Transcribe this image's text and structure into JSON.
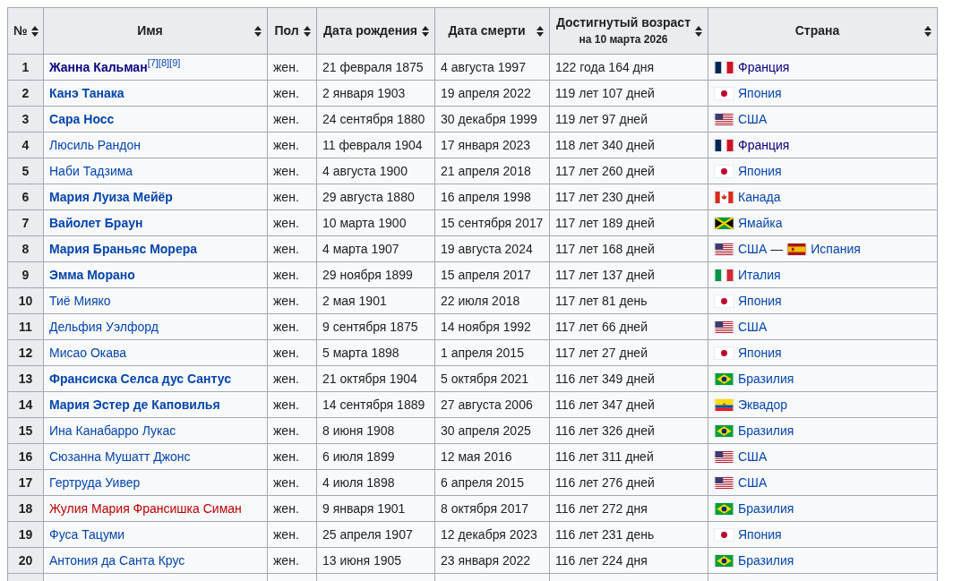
{
  "table": {
    "columns": [
      {
        "label": "№"
      },
      {
        "label": "Имя"
      },
      {
        "label": "Пол"
      },
      {
        "label": "Дата рождения"
      },
      {
        "label": "Дата смерти"
      },
      {
        "label": "Достигнутый возраст",
        "sublabel": "на 10 марта 2026"
      },
      {
        "label": "Страна"
      }
    ],
    "rows": [
      {
        "number": "1",
        "name": "Жанна Кальман",
        "bold": true,
        "visited": true,
        "missing": false,
        "refs": [
          "[7]",
          "[8]",
          "[9]"
        ],
        "sex": "жен.",
        "born": "21 февраля 1875",
        "died": "4 августа 1997",
        "age": "122 года 164 дня",
        "countries": [
          {
            "kind": "fr",
            "name": "Франция",
            "visited": true
          }
        ]
      },
      {
        "number": "2",
        "name": "Канэ Танака",
        "bold": true,
        "visited": false,
        "missing": false,
        "sex": "жен.",
        "born": "2 января 1903",
        "died": "19 апреля 2022",
        "age": "119 лет 107 дней",
        "countries": [
          {
            "kind": "jp",
            "name": "Япония",
            "visited": false
          }
        ]
      },
      {
        "number": "3",
        "name": "Сара Носс",
        "bold": true,
        "visited": false,
        "missing": false,
        "sex": "жен.",
        "born": "24 сентября 1880",
        "died": "30 декабря 1999",
        "age": "119 лет 97 дней",
        "countries": [
          {
            "kind": "us",
            "name": "США",
            "visited": false
          }
        ]
      },
      {
        "number": "4",
        "name": "Люсиль Рандон",
        "bold": false,
        "visited": false,
        "missing": false,
        "sex": "жен.",
        "born": "11 февраля 1904",
        "died": "17 января 2023",
        "age": "118 лет 340 дней",
        "countries": [
          {
            "kind": "fr",
            "name": "Франция",
            "visited": true
          }
        ]
      },
      {
        "number": "5",
        "name": "Наби Тадзима",
        "bold": false,
        "visited": false,
        "missing": false,
        "sex": "жен.",
        "born": "4 августа 1900",
        "died": "21 апреля 2018",
        "age": "117 лет 260 дней",
        "countries": [
          {
            "kind": "jp",
            "name": "Япония",
            "visited": false
          }
        ]
      },
      {
        "number": "6",
        "name": "Мария Луиза Мейёр",
        "bold": true,
        "visited": false,
        "missing": false,
        "sex": "жен.",
        "born": "29 августа 1880",
        "died": "16 апреля 1998",
        "age": "117 лет 230 дней",
        "countries": [
          {
            "kind": "ca",
            "name": "Канада",
            "visited": false
          }
        ]
      },
      {
        "number": "7",
        "name": "Вайолет Браун",
        "bold": true,
        "visited": false,
        "missing": false,
        "sex": "жен.",
        "born": "10 марта 1900",
        "died": "15 сентября 2017",
        "age": "117 лет 189 дней",
        "countries": [
          {
            "kind": "jm",
            "name": "Ямайка",
            "visited": false
          }
        ]
      },
      {
        "number": "8",
        "name": "Мария Браньяс Морера",
        "bold": true,
        "visited": false,
        "missing": false,
        "sex": "жен.",
        "born": "4 марта 1907",
        "died": "19 августа 2024",
        "age": "117 лет 168 дней",
        "countries": [
          {
            "kind": "us",
            "name": "США",
            "visited": false
          },
          {
            "kind": "es",
            "name": "Испания",
            "visited": false
          }
        ],
        "separator": "—"
      },
      {
        "number": "9",
        "name": "Эмма Морано",
        "bold": true,
        "visited": false,
        "missing": false,
        "sex": "жен.",
        "born": "29 ноября 1899",
        "died": "15 апреля 2017",
        "age": "117 лет 137 дней",
        "countries": [
          {
            "kind": "it",
            "name": "Италия",
            "visited": false
          }
        ]
      },
      {
        "number": "10",
        "name": "Тиё Мияко",
        "bold": false,
        "visited": false,
        "missing": false,
        "sex": "жен.",
        "born": "2 мая 1901",
        "died": "22 июля 2018",
        "age": "117 лет 81 день",
        "countries": [
          {
            "kind": "jp",
            "name": "Япония",
            "visited": false
          }
        ]
      },
      {
        "number": "11",
        "name": "Дельфия Уэлфорд",
        "bold": false,
        "visited": false,
        "missing": false,
        "sex": "жен.",
        "born": "9 сентября 1875",
        "died": "14 ноября 1992",
        "age": "117 лет 66 дней",
        "countries": [
          {
            "kind": "us",
            "name": "США",
            "visited": false
          }
        ]
      },
      {
        "number": "12",
        "name": "Мисао Окава",
        "bold": false,
        "visited": false,
        "missing": false,
        "sex": "жен.",
        "born": "5 марта 1898",
        "died": "1 апреля 2015",
        "age": "117 лет 27 дней",
        "countries": [
          {
            "kind": "jp",
            "name": "Япония",
            "visited": false
          }
        ]
      },
      {
        "number": "13",
        "name": "Франсиска Селса дус Сантус",
        "bold": true,
        "visited": false,
        "missing": false,
        "sex": "жен.",
        "born": "21 октября 1904",
        "died": "5 октября 2021",
        "age": "116 лет 349 дней",
        "countries": [
          {
            "kind": "br",
            "name": "Бразилия",
            "visited": false
          }
        ]
      },
      {
        "number": "14",
        "name": "Мария Эстер де Каповилья",
        "bold": true,
        "visited": false,
        "missing": false,
        "sex": "жен.",
        "born": "14 сентября 1889",
        "died": "27 августа 2006",
        "age": "116 лет 347 дней",
        "countries": [
          {
            "kind": "ec",
            "name": "Эквадор",
            "visited": false
          }
        ]
      },
      {
        "number": "15",
        "name": "Ина Канабарро Лукас",
        "bold": false,
        "visited": false,
        "missing": false,
        "sex": "жен.",
        "born": "8 июня 1908",
        "died": "30 апреля 2025",
        "age": "116 лет 326 дней",
        "countries": [
          {
            "kind": "br",
            "name": "Бразилия",
            "visited": false
          }
        ]
      },
      {
        "number": "16",
        "name": "Сюзанна Мушатт Джонс",
        "bold": false,
        "visited": false,
        "missing": false,
        "sex": "жен.",
        "born": "6 июля 1899",
        "died": "12 мая 2016",
        "age": "116 лет 311 дней",
        "countries": [
          {
            "kind": "us",
            "name": "США",
            "visited": false
          }
        ]
      },
      {
        "number": "17",
        "name": "Гертруда Уивер",
        "bold": false,
        "visited": false,
        "missing": false,
        "sex": "жен.",
        "born": "4 июля 1898",
        "died": "6 апреля 2015",
        "age": "116 лет 276 дней",
        "countries": [
          {
            "kind": "us",
            "name": "США",
            "visited": false
          }
        ]
      },
      {
        "number": "18",
        "name": "Жулия Мария Франсишка Симан",
        "bold": false,
        "visited": false,
        "missing": true,
        "sex": "жен.",
        "born": "9 января 1901",
        "died": "8 октября 2017",
        "age": "116 лет 272 дня",
        "countries": [
          {
            "kind": "br",
            "name": "Бразилия",
            "visited": false
          }
        ]
      },
      {
        "number": "19",
        "name": "Фуса Тацуми",
        "bold": false,
        "visited": false,
        "missing": false,
        "sex": "жен.",
        "born": "25 апреля 1907",
        "died": "12 декабря 2023",
        "age": "116 лет 231 день",
        "countries": [
          {
            "kind": "jp",
            "name": "Япония",
            "visited": false
          }
        ]
      },
      {
        "number": "20",
        "name": "Антония да Санта Крус",
        "bold": false,
        "visited": false,
        "missing": false,
        "sex": "жен.",
        "born": "13 июня 1905",
        "died": "23 января 2022",
        "age": "116 лет 224 дня",
        "countries": [
          {
            "kind": "br",
            "name": "Бразилия",
            "visited": false
          }
        ]
      }
    ]
  }
}
